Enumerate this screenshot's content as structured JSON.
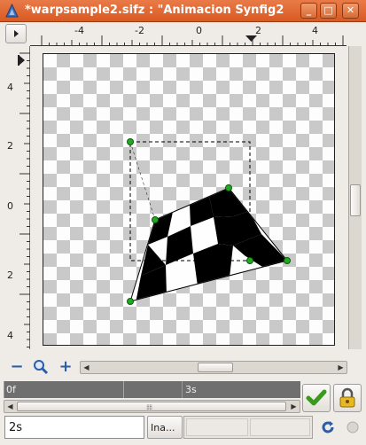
{
  "window": {
    "title": "*warpsample2.sifz : \"Animacion Synfig2",
    "controls": {
      "minimize": "_",
      "maximize": "□",
      "close": "✕"
    }
  },
  "rulers": {
    "horizontal_labels": [
      "-4",
      "-2",
      "0",
      "2",
      "4"
    ],
    "vertical_labels": [
      "4",
      "2",
      "0",
      "2",
      "4"
    ]
  },
  "zoom": {
    "zoom_out_icon": "zoom-out-icon",
    "zoom_fit_icon": "zoom-fit-icon",
    "zoom_in_icon": "zoom-in-icon"
  },
  "timetrack": {
    "start_label": "0f",
    "mid_label": "3s"
  },
  "bottom": {
    "time_value": "2s",
    "interpolation": "Ina..."
  },
  "colors": {
    "titlebar": "#d95a23",
    "timetrack": "#6f6f6f",
    "handle": "#22aa22",
    "time_cursor": "#e0a020"
  }
}
